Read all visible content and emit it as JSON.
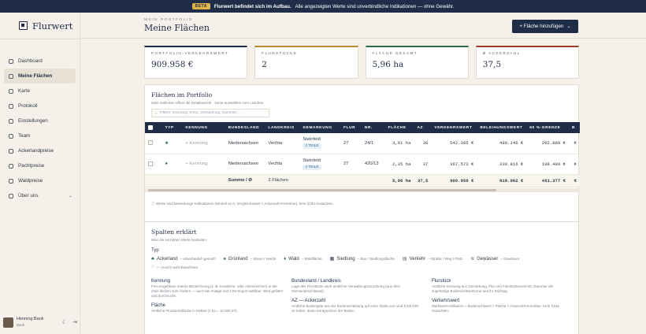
{
  "banner": {
    "badge": "BETA",
    "strong": "Flurwert befindet sich im Aufbau.",
    "text": "Alle angezeigten Werte sind unverbindliche Indikationen — ohne Gewähr."
  },
  "app": {
    "name": "Flurwert"
  },
  "nav": [
    {
      "label": "Dashboard",
      "icon": "home-icon"
    },
    {
      "label": "Meine Flächen",
      "icon": "fields-icon",
      "active": true
    },
    {
      "label": "Karte",
      "icon": "map-icon"
    },
    {
      "label": "Protokoll",
      "icon": "log-icon"
    },
    {
      "label": "Einstellungen",
      "icon": "settings-icon"
    },
    {
      "label": "Team",
      "icon": "team-icon"
    },
    {
      "label": "Ackerlandpreise",
      "icon": "chart-icon"
    },
    {
      "label": "Pachtpreise",
      "icon": "chart-icon"
    },
    {
      "label": "Waldpreise",
      "icon": "chart-icon"
    },
    {
      "label": "Über uns",
      "icon": "info-icon",
      "chevron": "⌄"
    }
  ],
  "user": {
    "name": "Henning Bank",
    "sub": "Bank"
  },
  "page": {
    "eyebrow": "MEIN PORTFOLIO",
    "title": "Meine Flächen",
    "add_button": "+ Fläche hinzufügen",
    "add_chevron": "⌄"
  },
  "kpis": [
    {
      "label": "PORTFOLIO-VERKEHRSWERT",
      "value": "909.958 €",
      "color": "#1f2d48"
    },
    {
      "label": "FLURSTÜCKE",
      "value": "2",
      "color": "#b8892f"
    },
    {
      "label": "FLÄCHE GESAMT",
      "value": "5,96 ha",
      "color": "#2f6b45"
    },
    {
      "label": "Ø ACKERZAHL",
      "value": "37,5",
      "color": "#9b3a2c"
    }
  ],
  "table_card": {
    "title": "Flächen im Portfolio",
    "hint": "Zeile anklicken öffnet die Detailansicht · some auswählen zum Löschen",
    "search_placeholder": "Filtern: Kennung, Kreis, Gemarkung, Nummer…",
    "columns": [
      "",
      "TYP",
      "KENNUNG",
      "BUNDESLAND",
      "LANDKREIS",
      "GEMARKUNG",
      "FLUR",
      "NR.",
      "FLÄCHE",
      "AZ",
      "VERKEHRSWERT",
      "BELEIHUNGSWERT",
      "60 %-GRENZE",
      "B"
    ],
    "rows": [
      {
        "kennung": "+ Kennung",
        "bundesland": "Niedersachsen",
        "landkreis": "Vechta",
        "gemarkung": "Steinfeld",
        "teile": "2 TEILE",
        "flur": "27",
        "nr": "24/1",
        "flaeche": "3,61 ha",
        "az": "38",
        "verkehrswert": "542.385 €",
        "beleihungswert": "488.146 €",
        "grenze": "292.888 €",
        "b": "€"
      },
      {
        "kennung": "+ Kennung",
        "bundesland": "Niedersachsen",
        "landkreis": "Vechta",
        "gemarkung": "Steinfeld",
        "teile": "3 TEILE",
        "flur": "27",
        "nr": "420/13",
        "flaeche": "2,35 ha",
        "az": "37",
        "verkehrswert": "367.573 €",
        "beleihungswert": "330.816 €",
        "grenze": "198.489 €",
        "b": "€"
      }
    ],
    "sum": {
      "label": "Summe / Ø",
      "count": "2 Flächen",
      "flaeche": "5,96 ha",
      "az": "37,5",
      "verkehrswert": "909.958 €",
      "beleihungswert": "818.962 €",
      "grenze": "491.377 €",
      "b": "€"
    },
    "footnote": "Werte sind Bewertungs-Indikationen (Modell v1.0, Vergleichswert × Ackerzahl-Korrektur), kein §194-Gutachten."
  },
  "legend_card": {
    "title": "Spalten erklärt",
    "sub": "Was die einzelnen Werte bedeuten.",
    "typ_label": "Typ",
    "types": [
      {
        "name": "Ackerland",
        "desc": "– ackerbaulich genutzt"
      },
      {
        "name": "Grünland",
        "desc": "– Wiese / Weide"
      },
      {
        "name": "Wald",
        "desc": "– Waldfläche"
      },
      {
        "name": "Siedlung",
        "desc": "– Bau / Siedlungsfläche"
      },
      {
        "name": "Verkehr",
        "desc": "– Straße / Weg / Platz"
      },
      {
        "name": "Gewässer",
        "desc": "– Gewässer"
      }
    ],
    "unknown": "— (noch) nicht klassifiziert",
    "defs": [
      {
        "t": "Kennung",
        "d": "Frei vergebbare interne Bezeichnung (z. B. Kundennr. oder Aktenzeichen) in der Zeile klicken zum Ändern — auch bei Anlage und CSV-Import wählbar. Wird gefiltert und durchsucht."
      },
      {
        "t": "Bundesland / Landkreis",
        "d": "Lage des Flurstücks nach amtlicher Verwaltungszuordnung (aus dem Gemeindeschlüssel)."
      },
      {
        "t": "Flurstück",
        "d": "Amtliche Kennung aus Gemarkung, Flur und Flurstücksnummer. Darunter die zugehörige Bodenrichtwertzone und ihr Stichtag."
      },
      {
        "t": "Fläche",
        "d": "Amtliche Flurstücksfläche in Hektar (1 ha = 10.000 m²)."
      },
      {
        "t": "AZ — Ackerzahl",
        "d": "Amtliche Bodengüte aus der Bodenschätzung auf einer Skala von rund 0 bis 100. Je höher, desto ertragreicher der Boden."
      },
      {
        "t": "Verkehrswert",
        "d": "Marktwert-Indikation = Bodenrichtwert × Fläche × Ackerzahl-Korrektur. Kein §194-Gutachten."
      }
    ]
  }
}
